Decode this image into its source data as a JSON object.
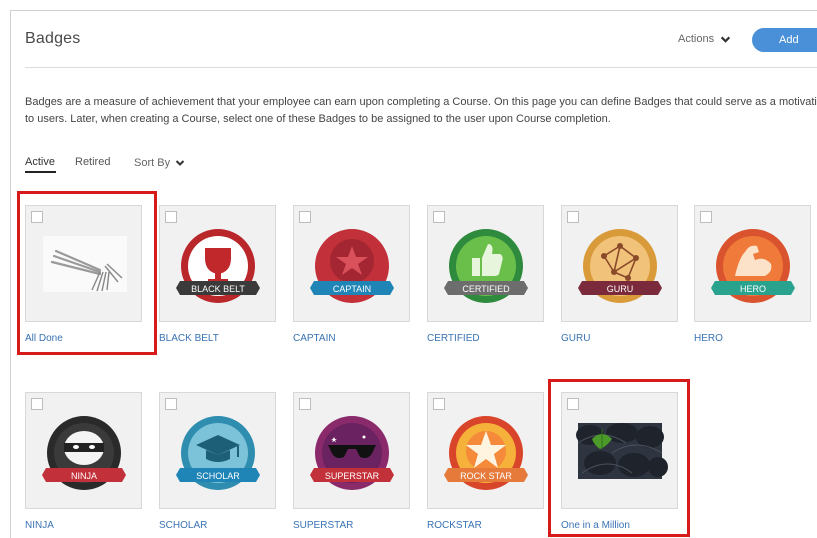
{
  "page": {
    "title": "Badges",
    "actions_label": "Actions",
    "add_label": "Add",
    "description_line1": "Badges are a measure of achievement that your employee can earn upon completing a Course. On this page you can define Badges that could serve as a motivati",
    "description_line2": "to users. Later, when creating a Course, select one of these Badges to be assigned to the user upon Course completion."
  },
  "tabs": {
    "active": "Active",
    "retired": "Retired",
    "sort_by": "Sort By"
  },
  "badges": [
    {
      "label": "All Done",
      "ribbon": ""
    },
    {
      "label": "BLACK BELT",
      "ribbon": "BLACK BELT"
    },
    {
      "label": "CAPTAIN",
      "ribbon": "CAPTAIN"
    },
    {
      "label": "CERTIFIED",
      "ribbon": "CERTIFIED"
    },
    {
      "label": "GURU",
      "ribbon": "GURU"
    },
    {
      "label": "HERO",
      "ribbon": "HERO"
    },
    {
      "label": "NINJA",
      "ribbon": "NINJA"
    },
    {
      "label": "SCHOLAR",
      "ribbon": "SCHOLAR"
    },
    {
      "label": "SUPERSTAR",
      "ribbon": "SUPERSTAR"
    },
    {
      "label": "ROCKSTAR",
      "ribbon": "ROCK STAR"
    },
    {
      "label": "One in a Million",
      "ribbon": ""
    }
  ],
  "colors": {
    "accent": "#4a90d9",
    "link": "#3a73b4",
    "highlight": "#d71a1a"
  }
}
